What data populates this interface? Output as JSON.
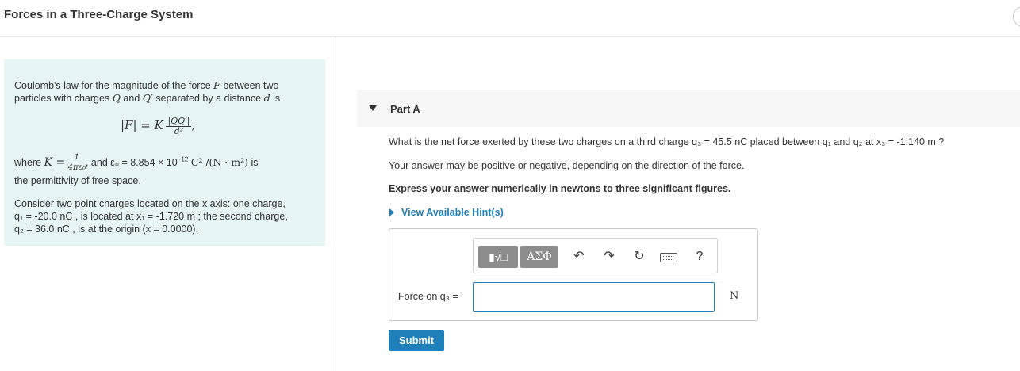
{
  "header": {
    "title": "Forces in a Three-Charge System"
  },
  "intro": {
    "p1_l1": "Coulomb's law for the magnitude of the force",
    "p1_F": "F",
    "p1_l1b": "between two",
    "p1_l2a": "particles with charges",
    "p1_Q": "Q",
    "p1_and": "and",
    "p1_Qp": "Q′",
    "p1_l2b": "separated by a distance",
    "p1_d": "d",
    "p1_is": "is",
    "formula_lhs": "|F| = K",
    "formula_num": "|QQ′|",
    "formula_den": "d²",
    "where": "where",
    "K_eq": "K =",
    "K_num": "1",
    "K_den": "4πε₀",
    "and_eps": ", and ε₀ = 8.854 × 10",
    "eps_exp": "−12",
    "eps_units": "C² /(N · m²)",
    "is": "is",
    "permittivity": "the permittivity of free space.",
    "p2_l1": "Consider two point charges located on the x axis: one charge,",
    "p2_l2": "q₁ = -20.0 nC , is located at x₁ = -1.720 m ; the second charge,",
    "p2_l3": "q₂ = 36.0 nC , is at the origin (x = 0.0000)."
  },
  "part": {
    "label": "Part A"
  },
  "question": {
    "q1": "What is the net force exerted by these two charges on a third charge q₃ = 45.5 nC placed between q₁ and q₂ at x₃ = -1.140 m ?",
    "q2": "Your answer may be positive or negative, depending on the direction of the force.",
    "q3": "Express your answer numerically in newtons to three significant figures."
  },
  "hints": {
    "label": "View Available Hint(s)"
  },
  "toolbar": {
    "templates": "▮√□",
    "symbols": "ΑΣΦ",
    "undo": "↶",
    "redo": "↷",
    "reset": "↻",
    "help": "?"
  },
  "answer": {
    "label": "Force on q₃ =",
    "value": "",
    "unit": "N"
  },
  "submit": {
    "label": "Submit"
  }
}
